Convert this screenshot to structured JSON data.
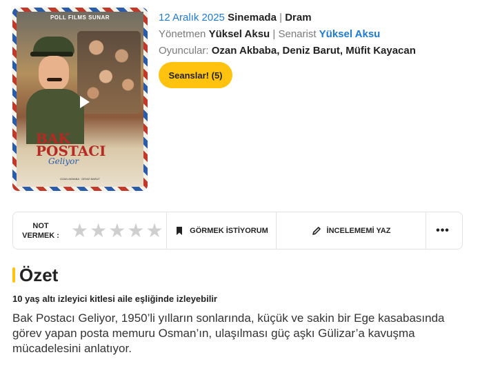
{
  "poster": {
    "studio": "POLL FILMS SUNAR",
    "title_line1": "BAK",
    "title_line2": "POSTACI",
    "title_line3": "Geliyor",
    "credits": "OZAN AKBABA · DENIZ BARUT"
  },
  "info": {
    "date": "12 Aralık 2025",
    "status": "Sinemada",
    "genre": "Dram",
    "director_label": "Yönetmen",
    "director": "Yüksel Aksu",
    "writer_label": "Senarist",
    "writer": "Yüksel Aksu",
    "cast_label": "Oyuncular:",
    "cast": [
      "Ozan Akbaba",
      "Deniz Barut",
      "Müfit Kayacan"
    ]
  },
  "sessions_button": "Seanslar! (5)",
  "actions": {
    "rate_label_line1": "NOT",
    "rate_label_line2": "VERMEK :",
    "star_count": 5,
    "watch_label": "GÖRMEK İSTİYORUM",
    "review_label": "İNCELEMEMİ YAZ",
    "more_label": "•••"
  },
  "summary": {
    "title": "Özet",
    "age_note": "10 yaş altı izleyici kitlesi aile eşliğinde izleyebilir",
    "text": "Bak Postacı Geliyor, 1950’li yılların sonlarında, küçük ve sakin bir Ege kasabasında görev yapan posta memuru Osman’ın, ulaşılması güç aşkı Gülizar’a kavuşma mücadelesini anlatıyor."
  },
  "colors": {
    "accent": "#ffc20e",
    "link": "#1e7ad1"
  },
  "icons": [
    "play-icon",
    "star-icon",
    "bookmark-icon",
    "pencil-icon",
    "more-icon"
  ]
}
